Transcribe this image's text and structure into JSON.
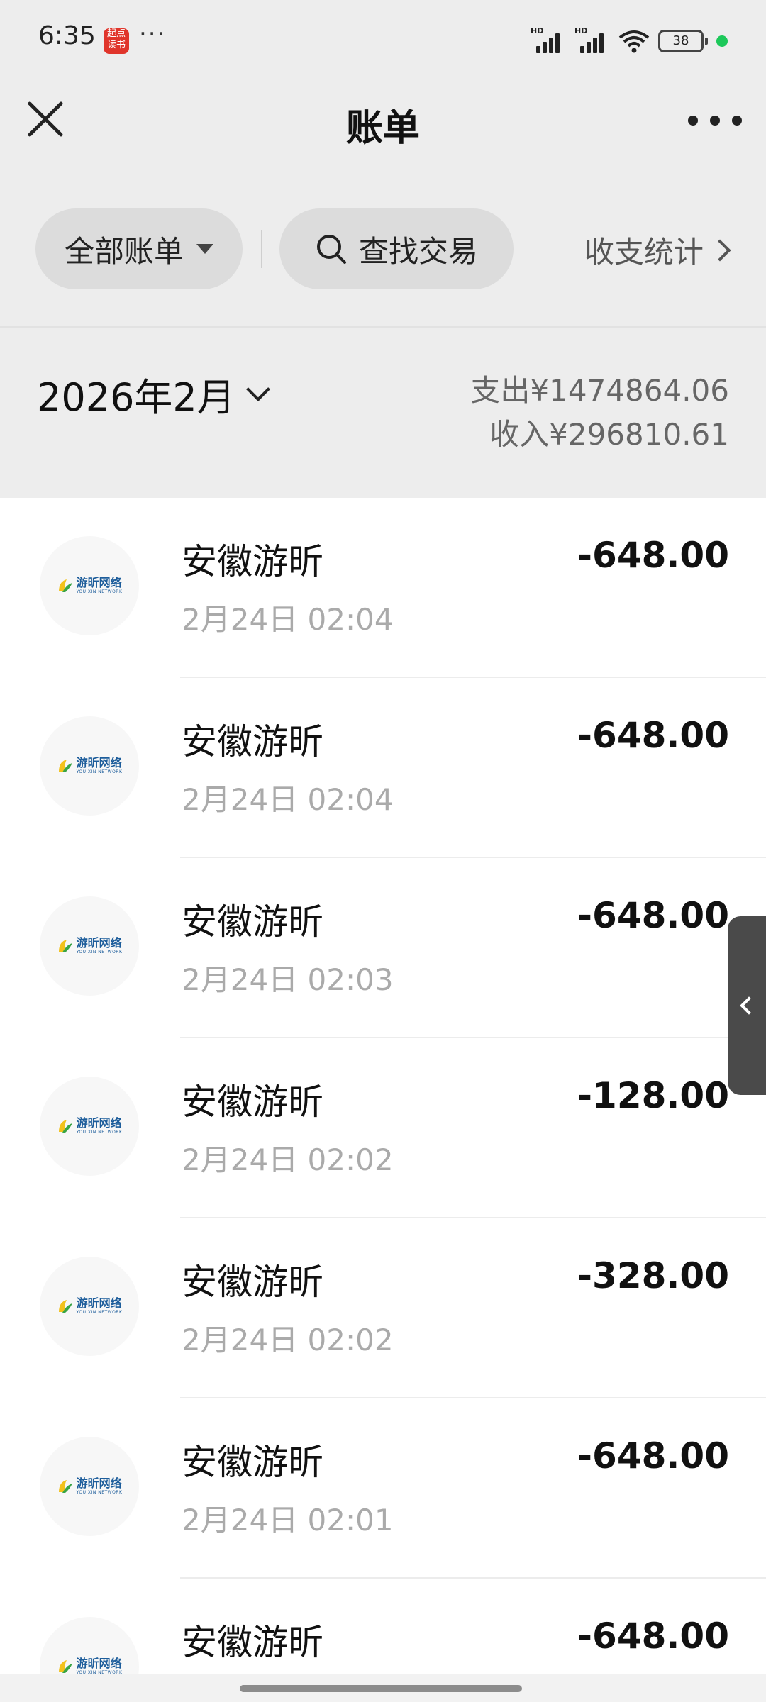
{
  "status_bar": {
    "time": "6:35",
    "app_badge_top": "起点",
    "app_badge_bottom": "读书",
    "more": "···",
    "battery": "38",
    "signal_label_1": "HD",
    "signal_label_2": "HD"
  },
  "nav": {
    "title": "账单",
    "close_icon": "close-icon",
    "more_icon": "more-icon"
  },
  "filters": {
    "all_bills": "全部账单",
    "search": "查找交易",
    "stats": "收支统计"
  },
  "month": {
    "label": "2026年2月",
    "expense": "支出¥1474864.06",
    "income": "收入¥296810.61"
  },
  "logo": {
    "cn": "游昕网络",
    "en": "YOU XIN NETWORK"
  },
  "transactions": [
    {
      "name": "安徽游昕",
      "time": "2月24日 02:04",
      "amount": "-648.00"
    },
    {
      "name": "安徽游昕",
      "time": "2月24日 02:04",
      "amount": "-648.00"
    },
    {
      "name": "安徽游昕",
      "time": "2月24日 02:03",
      "amount": "-648.00"
    },
    {
      "name": "安徽游昕",
      "time": "2月24日 02:02",
      "amount": "-128.00"
    },
    {
      "name": "安徽游昕",
      "time": "2月24日 02:02",
      "amount": "-328.00"
    },
    {
      "name": "安徽游昕",
      "time": "2月24日 02:01",
      "amount": "-648.00"
    },
    {
      "name": "安徽游昕",
      "time": "",
      "amount": "-648.00"
    }
  ]
}
